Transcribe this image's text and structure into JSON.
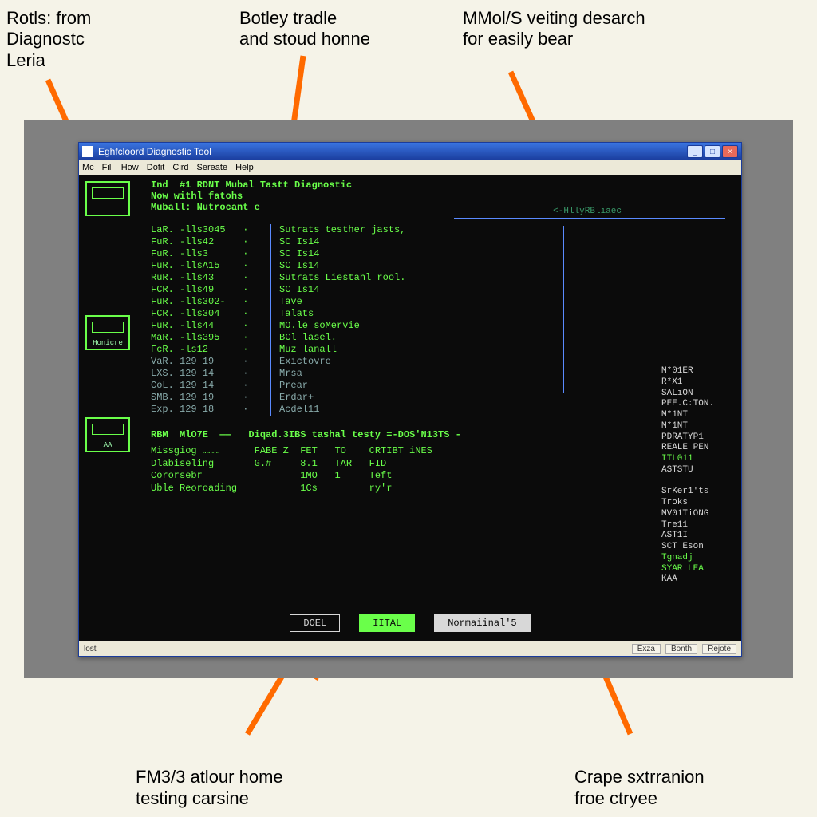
{
  "annotations": {
    "tl": "Rotls: from\nDiagnostc\nLeria",
    "tc": "Botley tradle\nand stoud honne",
    "tr": "MMol/S veiting desarch\nfor easily bear",
    "bl": "FM3/3 atlour home\ntesting carsine",
    "br": "Crape sxtrranion\nfroe ctryee"
  },
  "window": {
    "title": "Eghfcloord Diagnostic Tool",
    "menu": [
      "Mc",
      "Fill",
      "How",
      "Dofit",
      "Cird",
      "Sereate",
      "Help"
    ],
    "status_left": "lost",
    "status_right": [
      "Exza",
      "Bonth",
      "Rejote"
    ]
  },
  "terminal": {
    "header": {
      "l1": "Ind  #1 RDNT Mubal Tastt Diagnostic",
      "l2": "Now withl fatohs",
      "l3": "Muball: Nutrocant e",
      "right_tag": "<-HllyRBliaec"
    },
    "sidebar_icons": [
      {
        "name": "drive-icon",
        "label": ""
      },
      {
        "name": "monitor-icon",
        "label": "Honicre"
      },
      {
        "name": "disk-icon",
        "label": "AA"
      }
    ],
    "rows": [
      {
        "l": "LaR. -lls3045",
        "r": "Sutrats testher jasts,"
      },
      {
        "l": "FuR. -lls42",
        "r": "SC Is14"
      },
      {
        "l": "FuR. -lls3",
        "r": "SC Is14"
      },
      {
        "l": "FuR. -llsA15",
        "r": "SC Is14"
      },
      {
        "l": "RuR. -lls43",
        "r": "Sutrats Liestahl rool."
      },
      {
        "l": "FCR. -lls49",
        "r": "SC Is14"
      },
      {
        "l": "FuR. -lls302-",
        "r": "Tave"
      },
      {
        "l": "FCR. -lls304",
        "r": "Talats"
      },
      {
        "l": "FuR. -lls44",
        "r": "MO.le soMervie"
      },
      {
        "l": "MaR. -lls395",
        "r": "BCl lasel."
      },
      {
        "l": "FcR. -ls12",
        "r": "Muz lanall"
      },
      {
        "l": "VaR. 129 19",
        "r": "Exictovre",
        "dim": true
      },
      {
        "l": "LXS. 129 14",
        "r": "Mrsa",
        "dim": true
      },
      {
        "l": "CoL. 129 14",
        "r": "Prear",
        "dim": true
      },
      {
        "l": "SMB. 129 19",
        "r": "Erdar+",
        "dim": true
      },
      {
        "l": "Exp. 129 18",
        "r": "Acdel11",
        "dim": true
      }
    ],
    "section2": {
      "title": "RBM  MlO7E  ——   Diqad.3IBS tashal testy =-DOS'N13TS -",
      "rows": [
        {
          "a": "Missgiog ………",
          "b": "FABE Z",
          "c": "FET",
          "d": "TO",
          "e": "CRTIBT iNES"
        },
        {
          "a": "Dlabiseling",
          "b": "G.#",
          "c": "8.1",
          "d": "TAR",
          "e": "FID"
        },
        {
          "a": "Cororsebr",
          "b": "",
          "c": "1MO",
          "d": "1",
          "e": "Teft"
        },
        {
          "a": "Uble Reoroading",
          "b": "",
          "c": "1Cs",
          "d": "",
          "e": "ry'r"
        }
      ]
    },
    "right_list": [
      "M*01ER",
      "R*X1",
      "SALiON",
      "PEE.C:TON.",
      "M*1NT",
      "M*1NT",
      "PDRATYP1",
      "REALE  PEN",
      "ITL011",
      "ASTSTU",
      "",
      "SrKer1'ts",
      "Troks",
      "MV01TiONG",
      "Tre11",
      "AST1I",
      "SCT Eson",
      "Tgnadj",
      "SYAR  LEA",
      "KAA"
    ],
    "right_list_highlight": [
      8,
      17,
      18
    ],
    "buttons": {
      "doel": "DOEL",
      "iital": "IITAL",
      "normal": "Normaiinal'5"
    }
  }
}
